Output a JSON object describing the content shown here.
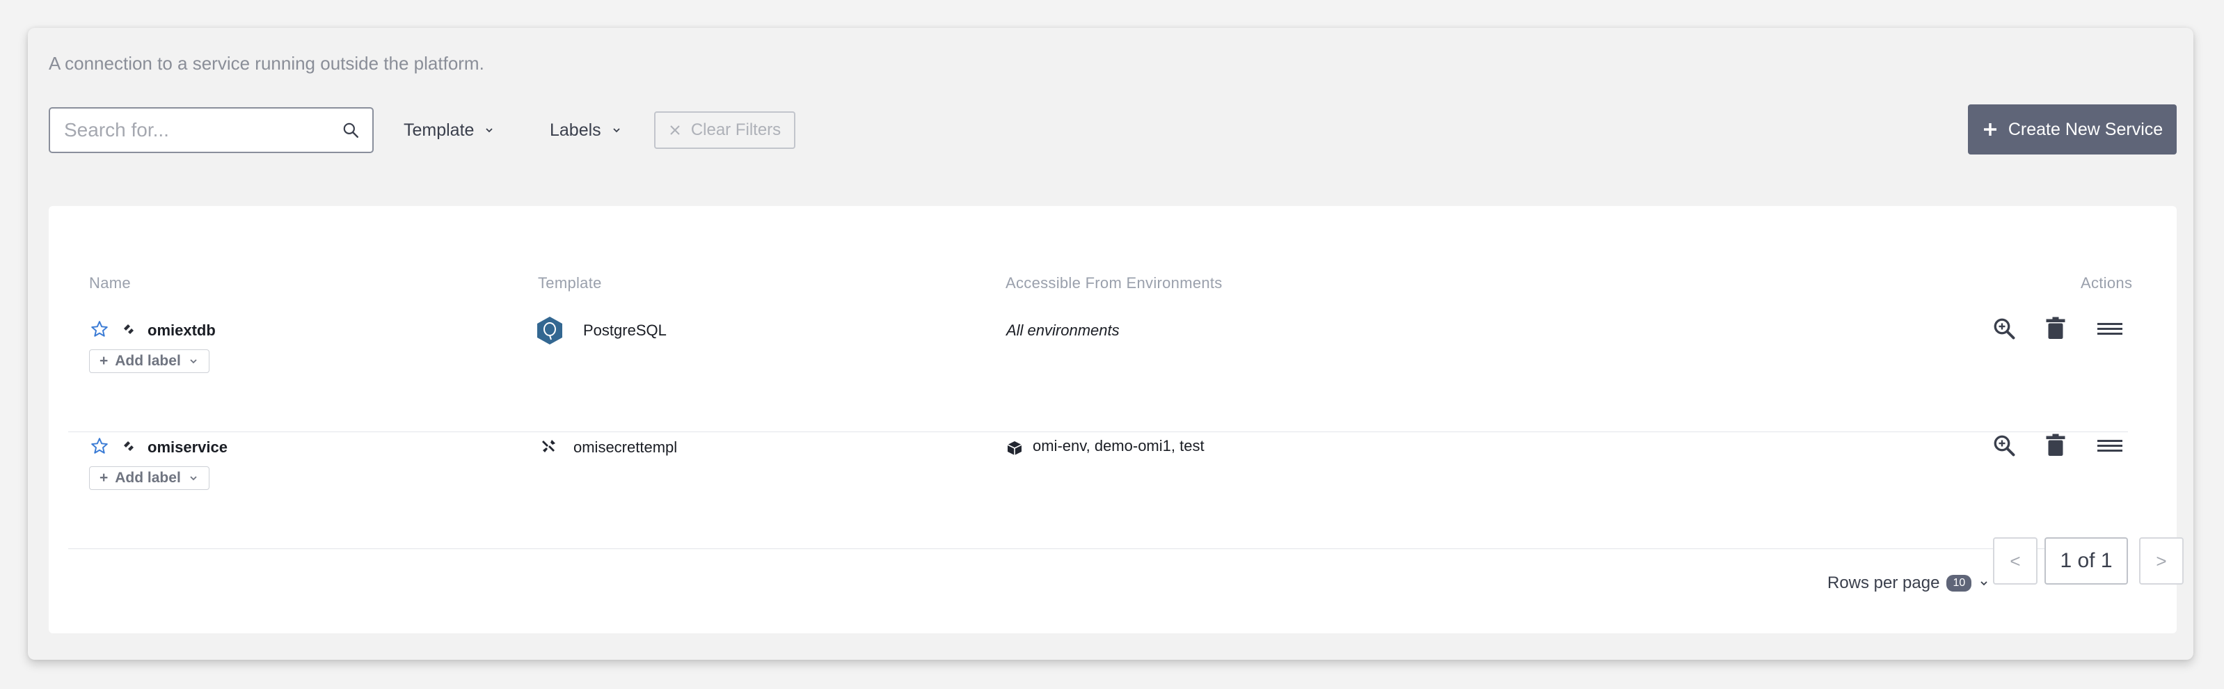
{
  "description": "A connection to a service running outside the platform.",
  "search": {
    "placeholder": "Search for..."
  },
  "filters": {
    "template_label": "Template",
    "labels_label": "Labels",
    "clear_label": "Clear Filters"
  },
  "create_button": {
    "label": "Create New Service"
  },
  "table": {
    "columns": {
      "name": "Name",
      "template": "Template",
      "environments": "Accessible From Environments",
      "actions": "Actions"
    },
    "rows": [
      {
        "name": "omiextdb",
        "template": "PostgreSQL",
        "template_icon": "postgresql-icon",
        "environments": "All environments",
        "add_label": "Add label"
      },
      {
        "name": "omiservice",
        "template": "omisecrettempl",
        "template_icon": "wrench-icon",
        "environments": "omi-env, demo-omi1, test",
        "add_label": "Add label"
      }
    ]
  },
  "pagination": {
    "rows_per_page_label": "Rows per page",
    "rows_per_page_value": "10",
    "prev": "<",
    "next": ">",
    "page_indicator": "1 of 1"
  },
  "colors": {
    "accent": "#5f6578",
    "star": "#3a7bd5",
    "postgres": "#336791"
  }
}
